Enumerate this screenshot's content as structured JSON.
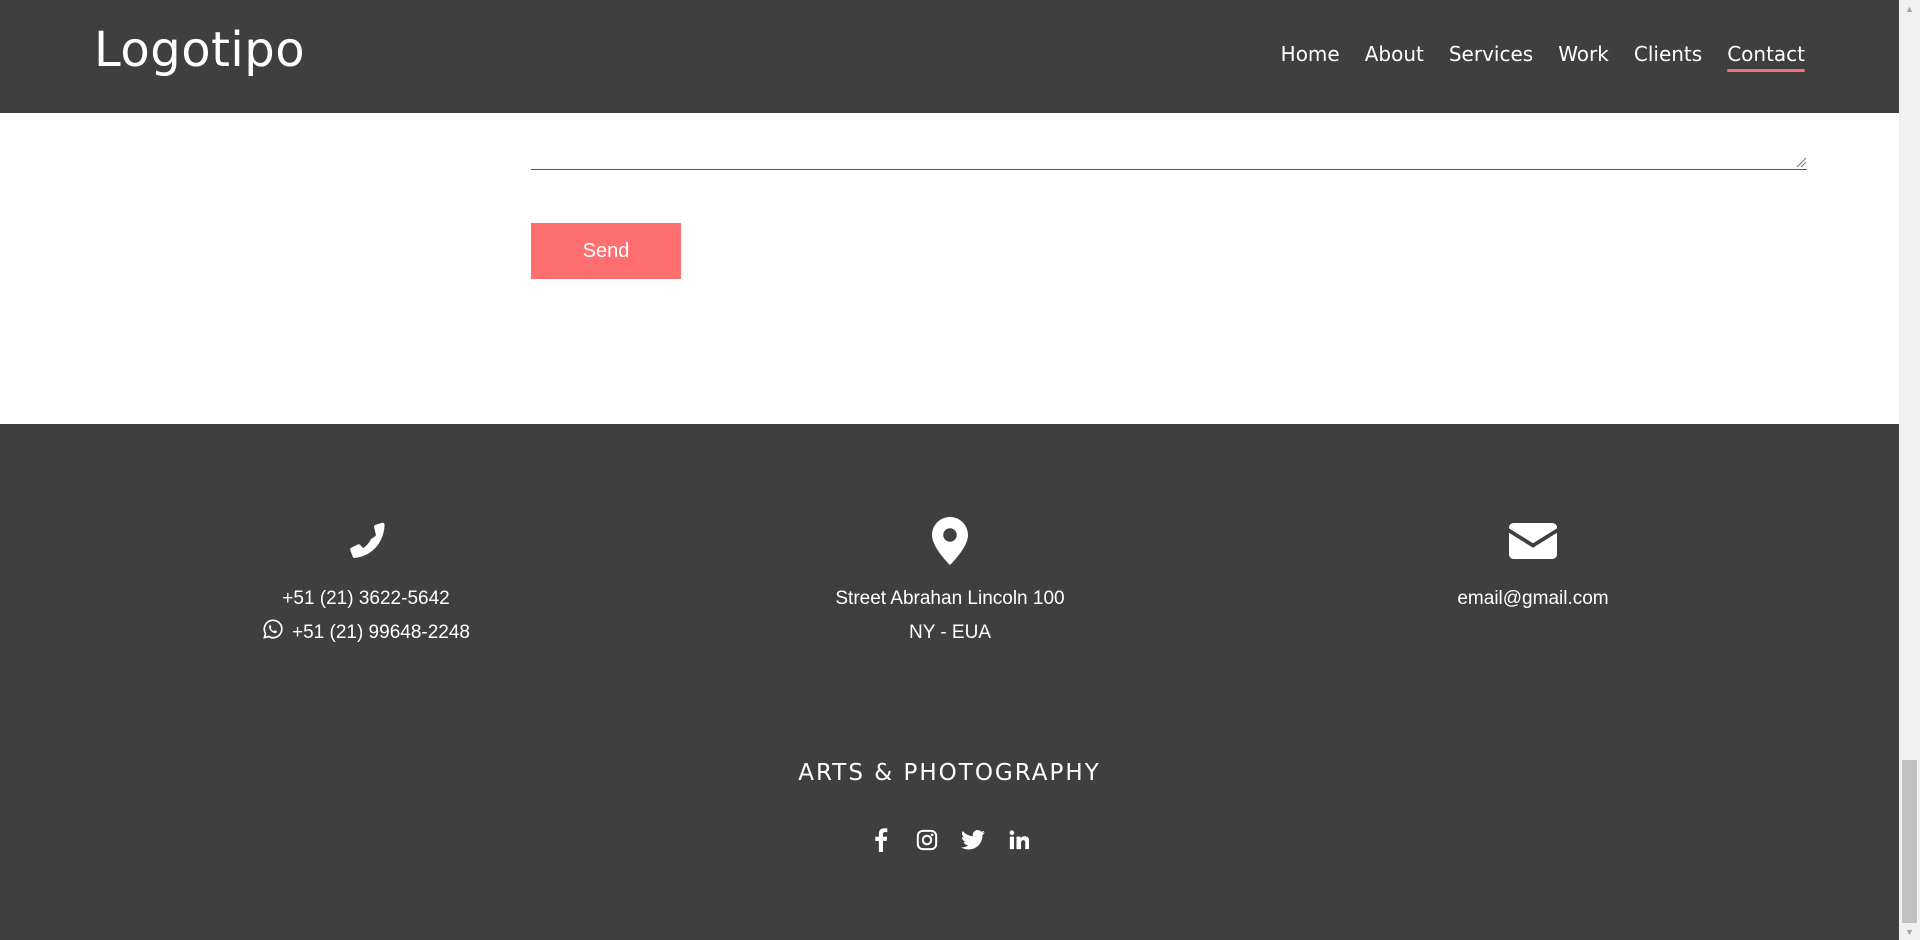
{
  "header": {
    "logo": "Logotipo",
    "nav": [
      {
        "label": "Home",
        "active": false
      },
      {
        "label": "About",
        "active": false
      },
      {
        "label": "Services",
        "active": false
      },
      {
        "label": "Work",
        "active": false
      },
      {
        "label": "Clients",
        "active": false
      },
      {
        "label": "Contact",
        "active": true
      }
    ]
  },
  "form": {
    "send_label": "Send"
  },
  "footer": {
    "phone": {
      "icon": "phone-icon",
      "number": "+51 (21) 3622-5642",
      "whatsapp_icon": "whatsapp-icon",
      "whatsapp": "+51 (21) 99648-2248"
    },
    "address": {
      "icon": "map-pin-icon",
      "line1": "Street Abrahan Lincoln 100",
      "line2": "NY - EUA"
    },
    "email": {
      "icon": "envelope-icon",
      "address": "email@gmail.com"
    },
    "tagline": "ARTS & PHOTOGRAPHY",
    "social": [
      "facebook-icon",
      "instagram-icon",
      "twitter-icon",
      "linkedin-icon"
    ]
  },
  "colors": {
    "dark_bg": "#3f3f3f",
    "accent": "#ff6f6f",
    "active_underline": "#f47174"
  }
}
